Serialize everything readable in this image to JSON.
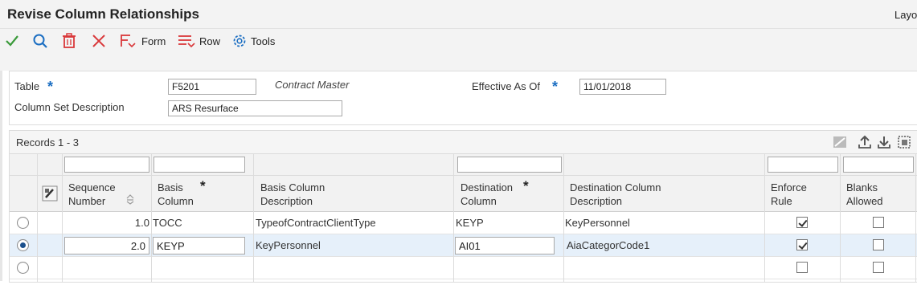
{
  "window": {
    "title": "Revise Column Relationships",
    "layout_link": "Layo"
  },
  "toolbar": {
    "form_label": "Form",
    "row_label": "Row",
    "tools_label": "Tools"
  },
  "header": {
    "table_label": "Table",
    "table_value": "F5201",
    "table_desc": "Contract Master",
    "effective_label": "Effective As Of",
    "effective_value": "11/01/2018",
    "colset_label": "Column Set Description",
    "colset_value": "ARS Resurface"
  },
  "grid": {
    "records_label": "Records 1 - 3",
    "columns": {
      "seq_line1": "Sequence",
      "seq_line2": "Number",
      "basis_line1": "Basis",
      "basis_line2": "Column",
      "basisdesc_line1": "Basis Column",
      "basisdesc_line2": "Description",
      "dest_line1": "Destination",
      "dest_line2": "Column",
      "destdesc_line1": "Destination Column",
      "destdesc_line2": "Description",
      "enforce_line1": "Enforce",
      "enforce_line2": "Rule",
      "blanks_line1": "Blanks",
      "blanks_line2": "Allowed"
    },
    "rows": [
      {
        "selected": false,
        "seq": "1.0",
        "basis": "TOCC",
        "basis_desc": "TypeofContractClientType",
        "dest": "KEYP",
        "dest_desc": "KeyPersonnel",
        "enforce": true,
        "blanks": false
      },
      {
        "selected": true,
        "seq": "2.0",
        "basis": "KEYP",
        "basis_desc": "KeyPersonnel",
        "dest": "AI01",
        "dest_desc": "AiaCategorCode1",
        "enforce": true,
        "blanks": false
      },
      {
        "selected": false,
        "seq": "",
        "basis": "",
        "basis_desc": "",
        "dest": "",
        "dest_desc": "",
        "enforce": false,
        "blanks": false
      }
    ]
  },
  "colors": {
    "accent_blue": "#1b6ec2",
    "ok_green": "#3a9a3a",
    "delete_red": "#d9383a",
    "selected_row": "#e6f0fa"
  }
}
